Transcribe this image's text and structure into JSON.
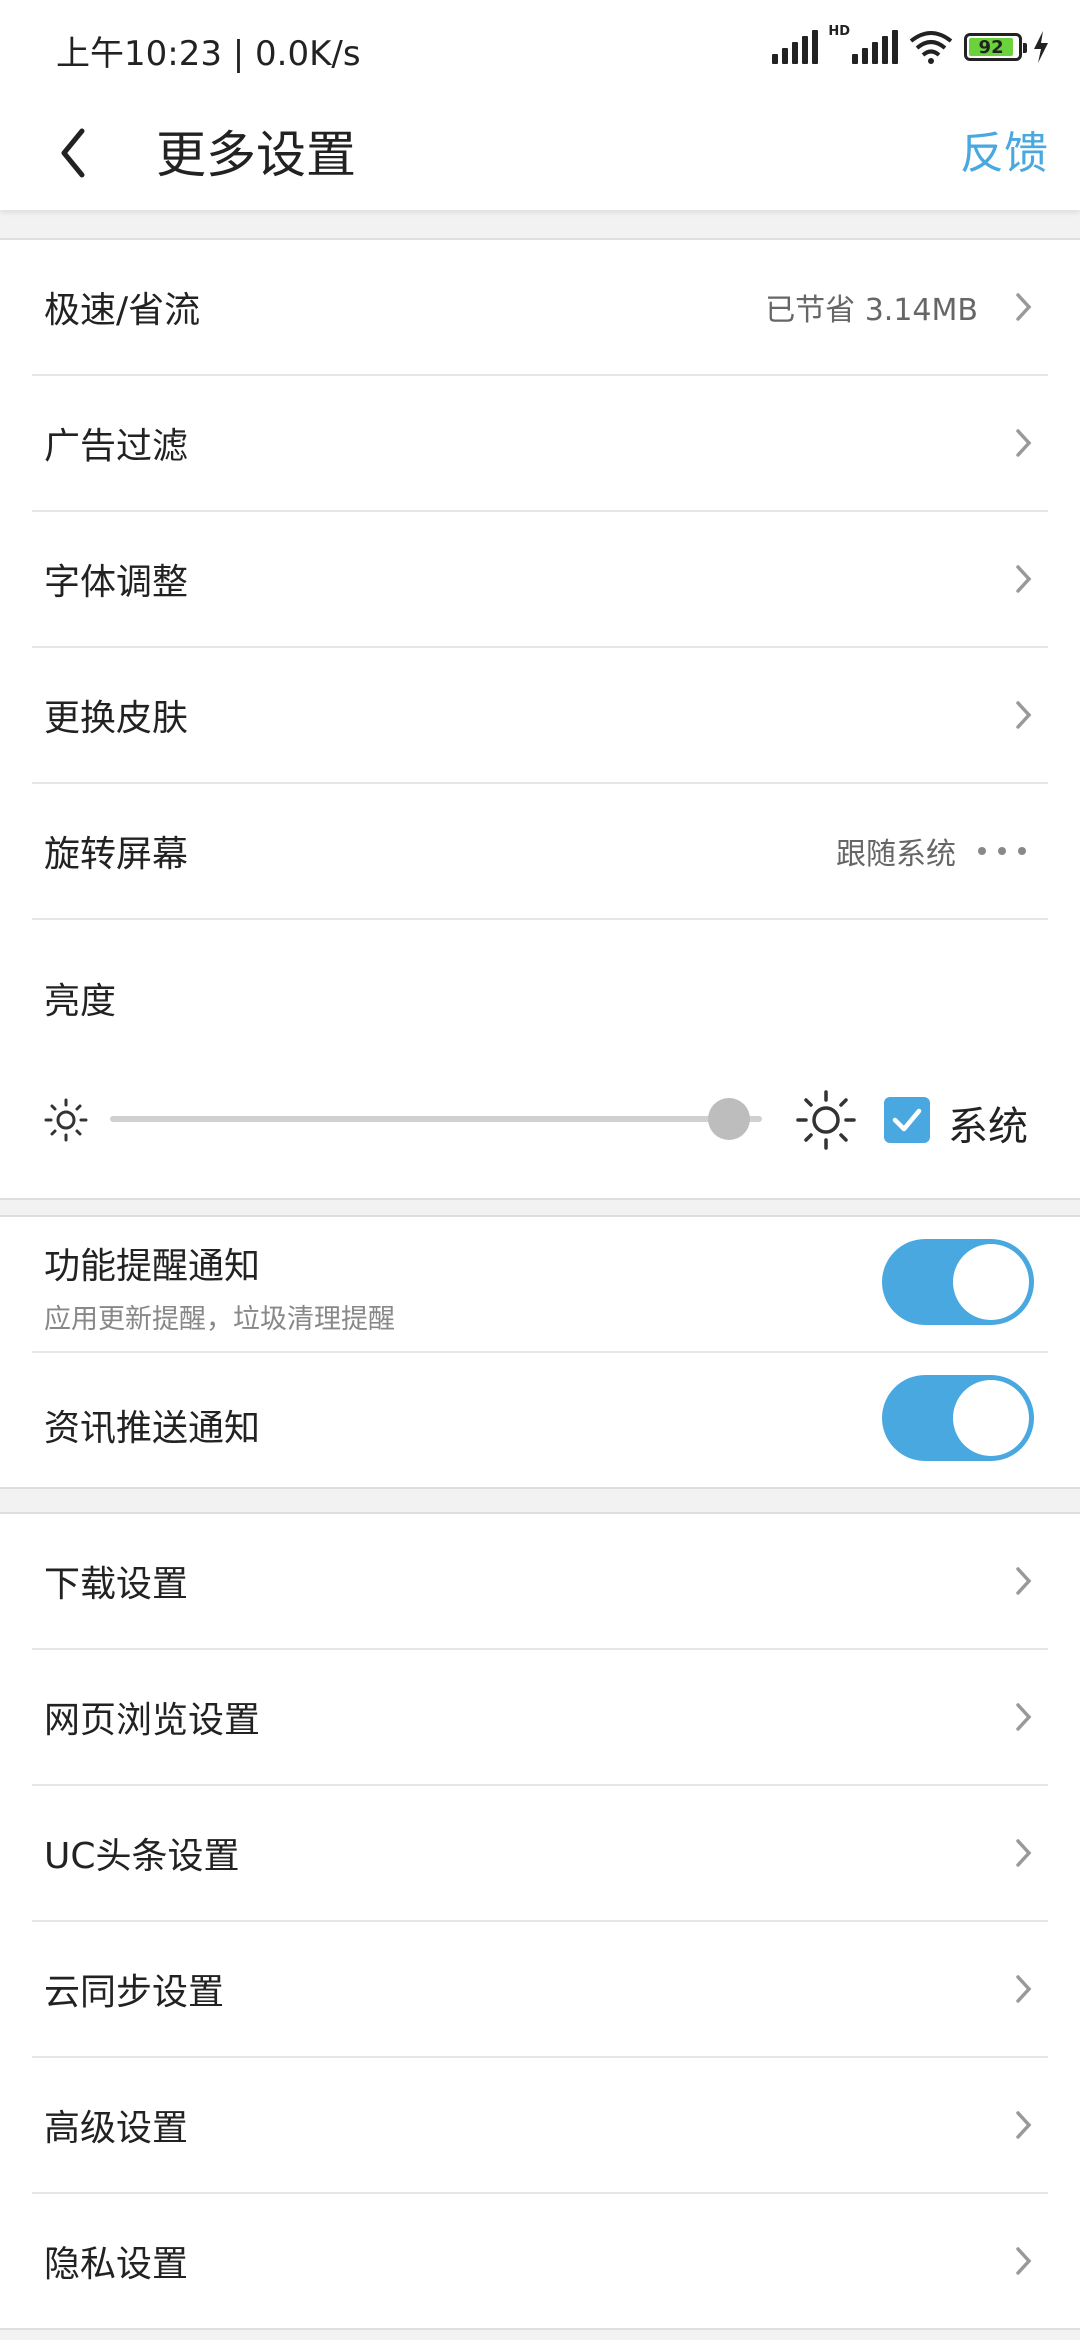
{
  "status": {
    "time": "上午10:23 | 0.0K/s",
    "hd": "HD",
    "battery": "92"
  },
  "header": {
    "title": "更多设置",
    "feedback": "反馈"
  },
  "section1": {
    "speed": {
      "label": "极速/省流",
      "value": "已节省 3.14MB"
    },
    "adblock": {
      "label": "广告过滤"
    },
    "font": {
      "label": "字体调整"
    },
    "skin": {
      "label": "更换皮肤"
    },
    "rotate": {
      "label": "旋转屏幕",
      "value": "跟随系统"
    },
    "brightness": {
      "label": "亮度",
      "system_label": "系统",
      "system_checked": true,
      "level": 0.95
    }
  },
  "section2": {
    "feature_notify": {
      "label": "功能提醒通知",
      "sub": "应用更新提醒，垃圾清理提醒",
      "on": true
    },
    "news_notify": {
      "label": "资讯推送通知",
      "on": true
    }
  },
  "section3": {
    "items": [
      {
        "label": "下载设置"
      },
      {
        "label": "网页浏览设置"
      },
      {
        "label": "UC头条设置"
      },
      {
        "label": "云同步设置"
      },
      {
        "label": "高级设置"
      },
      {
        "label": "隐私设置"
      }
    ]
  },
  "colors": {
    "accent": "#4aa8e0",
    "battery": "#6ad23a"
  }
}
